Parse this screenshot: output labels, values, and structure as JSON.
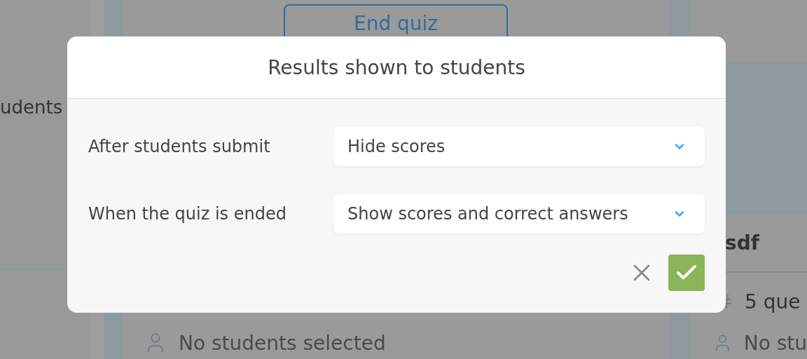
{
  "background": {
    "left_card": {
      "text": "udents"
    },
    "center_card": {
      "end_button": "End quiz",
      "students": "No students selected"
    },
    "right_card": {
      "title": "sdf",
      "questions": "5 que",
      "students": "No stu"
    }
  },
  "dialog": {
    "title": "Results shown to students",
    "settings": [
      {
        "label": "After students submit",
        "value": "Hide scores"
      },
      {
        "label": "When the quiz is ended",
        "value": "Show scores and correct answers"
      }
    ]
  }
}
